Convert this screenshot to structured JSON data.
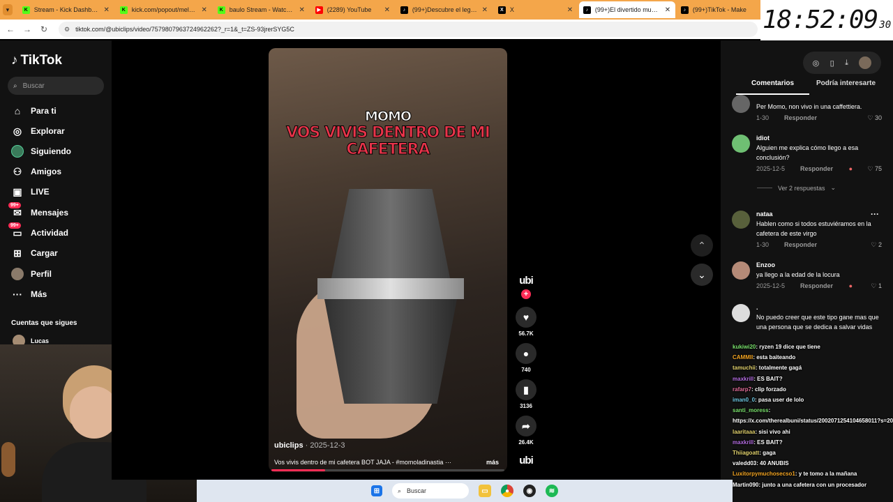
{
  "browser": {
    "tabs": [
      {
        "title": "Stream - Kick Dashboard",
        "icon": "kick-icon",
        "color": "#53fc18"
      },
      {
        "title": "kick.com/popout/meliana",
        "icon": "kick-icon",
        "color": "#53fc18"
      },
      {
        "title": "baulo Stream - Watch Live",
        "icon": "kick-icon",
        "color": "#53fc18"
      },
      {
        "title": "(2289) YouTube",
        "icon": "youtube-icon",
        "color": "#ff0000"
      },
      {
        "title": "(99+)Descubre el legado",
        "icon": "tiktok-icon",
        "color": "#000000"
      },
      {
        "title": "X",
        "icon": "x-icon",
        "color": "#000000"
      },
      {
        "title": "(99+)El divertido mundo",
        "icon": "tiktok-icon",
        "color": "#000000",
        "active": true
      },
      {
        "title": "(99+)TikTok - Make",
        "icon": "tiktok-icon",
        "color": "#000000"
      }
    ],
    "url": "tiktok.com/@ubiclips/video/7579807963724962262?_r=1&_t=ZS-93jrerSYG5C"
  },
  "clock": {
    "time": "18:52:09",
    "fraction": "30"
  },
  "sidebar": {
    "logo": "TikTok",
    "search_placeholder": "Buscar",
    "items": [
      {
        "label": "Para ti",
        "icon": "home-icon"
      },
      {
        "label": "Explorar",
        "icon": "compass-icon"
      },
      {
        "label": "Siguiendo",
        "icon": "following-avatar-icon"
      },
      {
        "label": "Amigos",
        "icon": "friends-icon"
      },
      {
        "label": "LIVE",
        "icon": "live-icon"
      },
      {
        "label": "Mensajes",
        "icon": "messages-icon",
        "badge": "99+"
      },
      {
        "label": "Actividad",
        "icon": "activity-icon",
        "badge": "99+"
      },
      {
        "label": "Cargar",
        "icon": "upload-icon"
      },
      {
        "label": "Perfil",
        "icon": "profile-avatar-icon"
      },
      {
        "label": "Más",
        "icon": "more-dots-icon"
      }
    ],
    "following_header": "Cuentas que sigues",
    "following_user": "Lucas"
  },
  "video": {
    "caption_line1": "MOMO",
    "caption_line2": "VOS VIVIS DENTRO DE MI",
    "caption_line3": "CAFETERA",
    "author": "ubiclips",
    "date": "· 2025-12-3",
    "description": "Vos vivis dentro de mi cafetera BOT JAJA - #momoladinastia ···",
    "more": "más",
    "progress": 0.23
  },
  "actions": {
    "likes": "56.7K",
    "comments": "740",
    "saves": "3136",
    "shares": "26.4K"
  },
  "right_panel": {
    "tab_comments": "Comentarios",
    "tab_interesting": "Podría interesarte",
    "comments": [
      {
        "name": "",
        "text": "Per Momo, non vivo in una caffettiera.",
        "date": "1-30",
        "reply": "Responder",
        "likes": "30",
        "color": "#666666"
      },
      {
        "name": "idiot",
        "text": "Alguien me explica cómo llego a esa conclusión?",
        "date": "2025-12-5",
        "reply": "Responder",
        "likes": "75",
        "color": "#6fbf73",
        "emoji": true
      },
      {
        "name": "nataa",
        "text": "Hablen como si todos estuviéramos en la cafetera de este virgo",
        "date": "1-30",
        "reply": "Responder",
        "likes": "2",
        "color": "#58603b"
      },
      {
        "name": "Enzoo",
        "text": "ya llego a la edad de la locura",
        "date": "2025-12-5",
        "reply": "Responder",
        "likes": "1",
        "color": "#b58a77",
        "emoji": true
      },
      {
        "name": ".",
        "text": "No puedo creer que este tipo gane mas que una persona que se dedica a salvar vidas",
        "date": "",
        "reply": "Responder",
        "likes": "1",
        "color": "#dddddd"
      }
    ],
    "more_replies": "Ver 2 respuestas"
  },
  "chat": [
    {
      "user": "kukiwi20",
      "msg": ": ryzen 19 dice que tiene",
      "color": "#7be36e"
    },
    {
      "user": "CAMMII",
      "msg": ": esta baiteando",
      "color": "#f5a623"
    },
    {
      "user": "tamuchii",
      "msg": ": totalmente gagá",
      "color": "#e3d36e"
    },
    {
      "user": "maxkrill",
      "msg": ": ES BAIT?",
      "color": "#b56ee3"
    },
    {
      "user": "rafarp7",
      "msg": ": clip forzado",
      "color": "#e36e9a"
    },
    {
      "user": "iman0_0",
      "msg": ": pasa user de lolo",
      "color": "#6ec8e3"
    },
    {
      "user": "santi_moress",
      "msg": ":",
      "color": "#7be36e"
    },
    {
      "user": "",
      "msg": "https://x.com/therealbuni/status/2002071254104658011?s=20",
      "color": "#ffffff"
    },
    {
      "user": "laaritaaa",
      "msg": ": sisi vivo ahi",
      "color": "#e3d36e"
    },
    {
      "user": "maxkrill",
      "msg": ": ES BAIT?",
      "color": "#b56ee3"
    },
    {
      "user": "Thiiagoatt",
      "msg": ": gaga",
      "color": "#e3d36e"
    },
    {
      "user": "valedd03",
      "msg": ": 40 ANUBIS",
      "color": "#ffffff"
    },
    {
      "user": "Luxitorpymuchosecso1",
      "msg": ": y te tomo a la mañana",
      "color": "#f5a623"
    },
    {
      "user": "Martin090",
      "msg": ": junto a una cafetera con un procesador",
      "color": "#ffffff"
    }
  ],
  "taskbar": {
    "search_placeholder": "Buscar"
  }
}
